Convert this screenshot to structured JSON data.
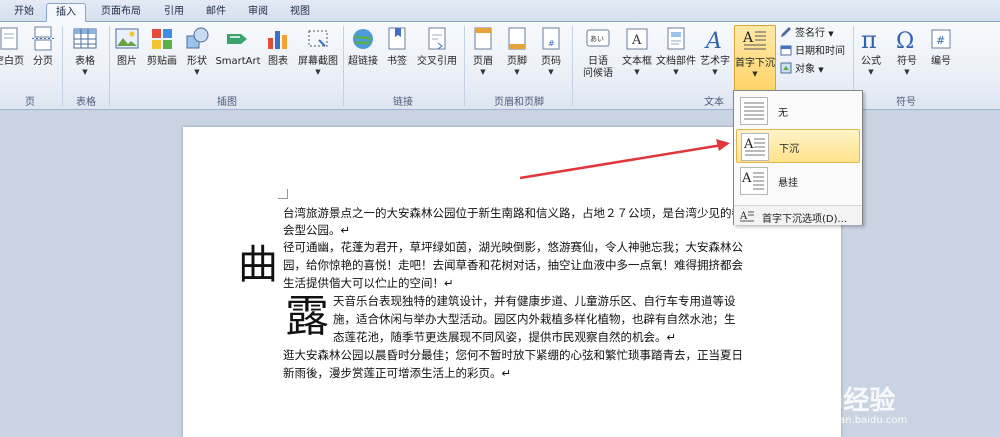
{
  "tabs": [
    {
      "label": "开始",
      "active": false
    },
    {
      "label": "插入",
      "active": true
    },
    {
      "label": "页面布局",
      "active": false
    },
    {
      "label": "引用",
      "active": false
    },
    {
      "label": "邮件",
      "active": false
    },
    {
      "label": "审阅",
      "active": false
    },
    {
      "label": "视图",
      "active": false
    }
  ],
  "ribbon": {
    "pages": {
      "blank_page": "空白页",
      "page_break": "分页",
      "group": "页"
    },
    "tables": {
      "table": "表格",
      "group": "表格"
    },
    "illustrations": {
      "picture": "图片",
      "clipart": "剪贴画",
      "shapes": "形状",
      "smartart": "SmartArt",
      "chart": "图表",
      "screenshot": "屏幕截图",
      "group": "插图"
    },
    "links": {
      "hyperlink": "超链接",
      "bookmark": "书签",
      "crossref": "交叉引用",
      "group": "链接"
    },
    "header_footer": {
      "header": "页眉",
      "footer": "页脚",
      "page_number": "页码",
      "group": "页眉和页脚"
    },
    "text": {
      "date_l1": "日语",
      "date_l2": "问候语",
      "textbox": "文本框",
      "docparts": "文档部件",
      "wordart": "艺术字",
      "dropcap": "首字下沉",
      "signature": "签名行",
      "datetime": "日期和时间",
      "object": "对象",
      "group": "文本"
    },
    "symbols": {
      "equation": "公式",
      "symbol": "符号",
      "number": "编号",
      "group": "符号"
    }
  },
  "dropcap_menu": {
    "items": [
      "无",
      "下沉",
      "悬挂"
    ],
    "options": "首字下沉选项(D)..."
  },
  "document": {
    "line1": "台湾旅游景点之一的大安森林公园位于新生南路和信义路，占地２７公顷，是台湾少见的都",
    "line2": "会型公园。↵",
    "dropcap1": "曲",
    "p2_1": "径可通幽，花蓬为君开，草坪绿如茵，湖光映倒影，悠游赛仙，令人神驰忘我；大安森林公",
    "p2_2": "园，给你惊艳的喜悦！走吧！去闻草香和花树对话，抽空让血液中多一点氧！难得拥挤都会",
    "p2_3": "生活提供偕大可以伫止的空间！↵",
    "dropcap2": "露",
    "p3_1": "天音乐台表现独特的建筑设计，并有健康步道、儿童游乐区、自行车专用道等设",
    "p3_2": "施，适合休闲与举办大型活动。园区内外栽植多样化植物，也辟有自然水池；生",
    "p3_3": "态莲花池，随季节更迭展现不同风姿，提供市民观察自然的机会。↵",
    "p4_1": "逛大安森林公园以晨昏时分最佳；您何不暂时放下紧绷的心弦和繁忙琐事踏青去，正当夏日",
    "p4_2": "新雨後，漫步赏莲正可增添生活上的彩页。↵"
  },
  "watermark": {
    "brand": "Baidu经验",
    "url": "jingyan.baidu.com"
  },
  "colors": {
    "accent": "#e0373b",
    "ribbon_bg": "#e9eef6",
    "highlight": "#ffd46a"
  }
}
